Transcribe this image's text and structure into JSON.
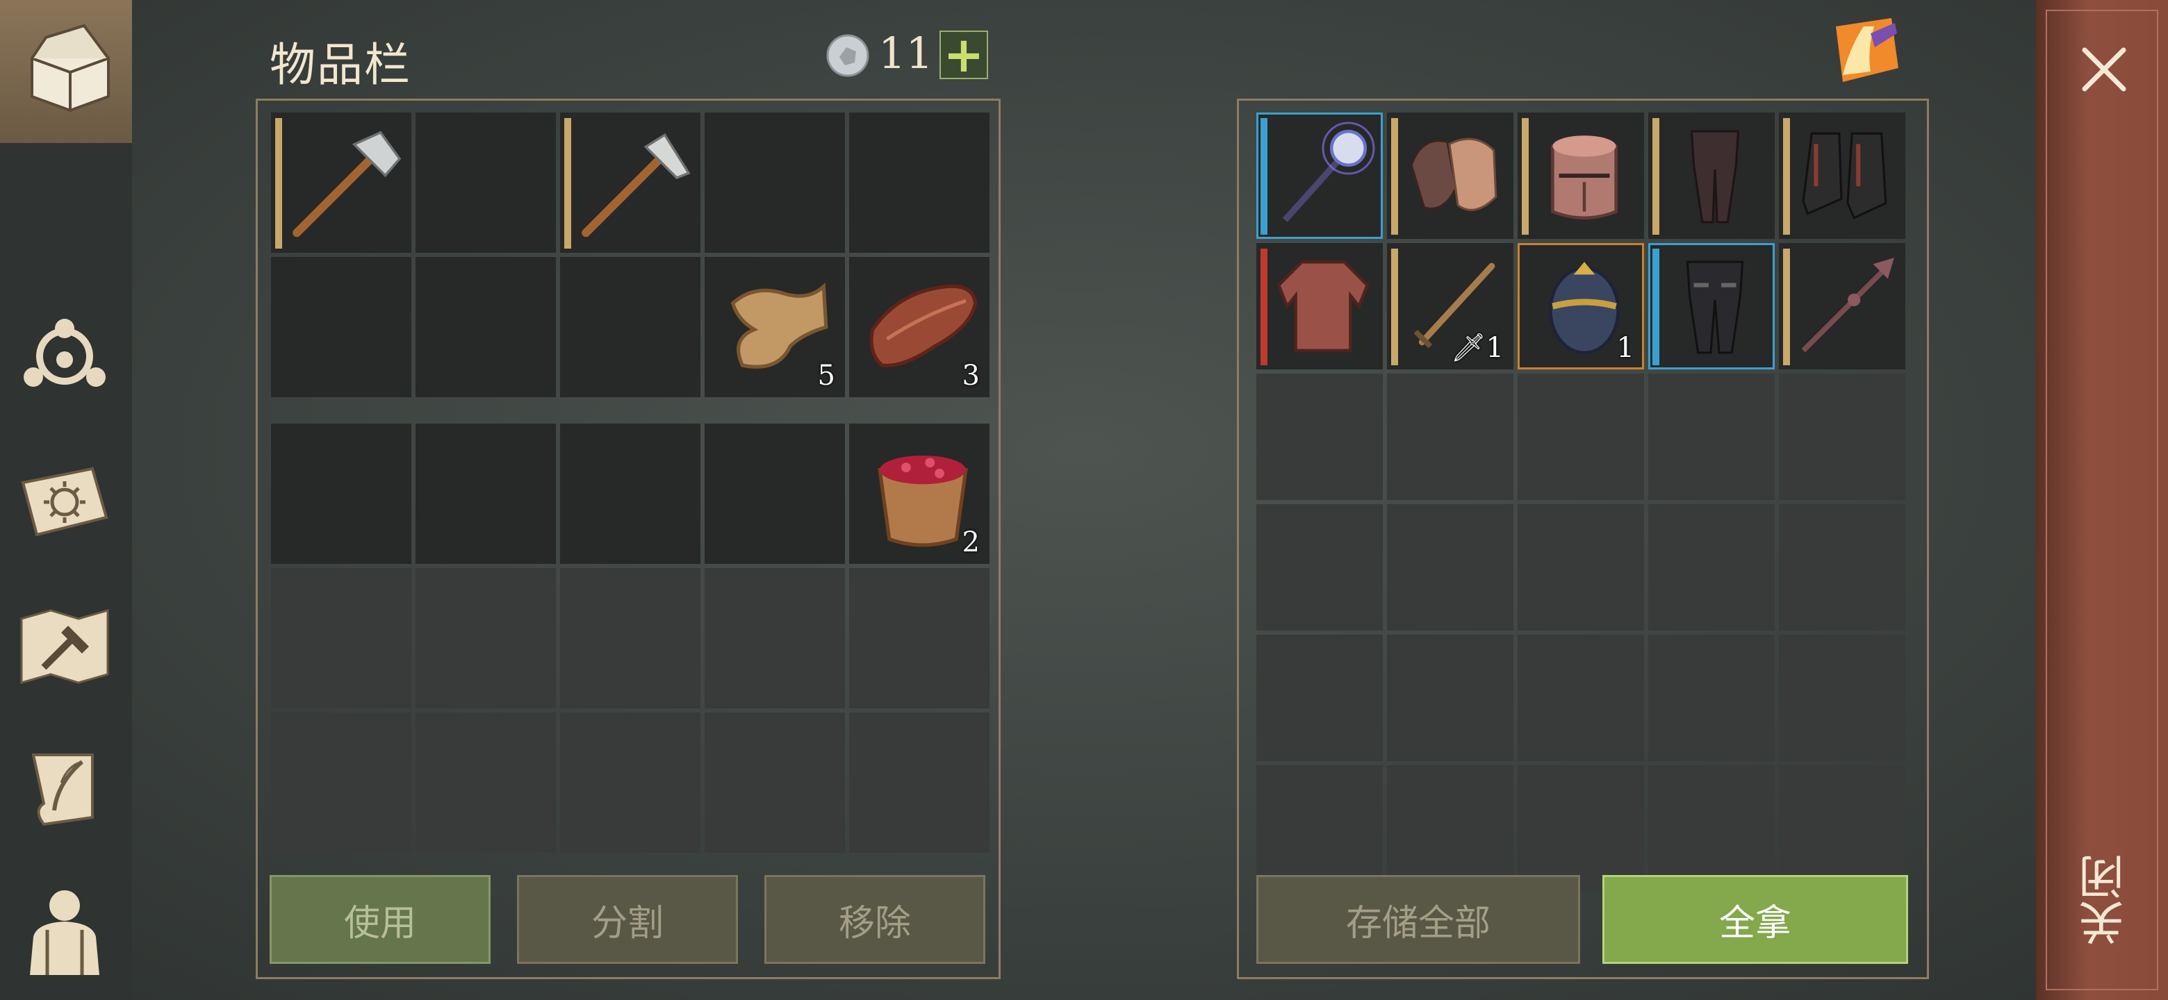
{
  "inventory": {
    "title": "物品栏",
    "currency_count": "11",
    "add_label": "+",
    "rows": [
      [
        {
          "item": "hammer-icon",
          "bar": "tan"
        },
        {
          "item": null
        },
        {
          "item": "pickaxe-icon",
          "bar": "tan"
        },
        {
          "item": null
        },
        {
          "item": null
        }
      ],
      [
        {
          "item": null
        },
        {
          "item": null
        },
        {
          "item": null
        },
        {
          "item": "cloth-icon",
          "qty": "5"
        },
        {
          "item": "leather-icon",
          "qty": "3"
        }
      ]
    ],
    "bottom_rows": [
      [
        {
          "item": null
        },
        {
          "item": null
        },
        {
          "item": null
        },
        {
          "item": null
        },
        {
          "item": "berry-bowl-icon",
          "qty": "2"
        }
      ]
    ],
    "buttons": {
      "use": "使用",
      "split": "分割",
      "remove": "移除"
    }
  },
  "container": {
    "rows": [
      [
        {
          "item": "mace-icon",
          "bar": "blue",
          "border": "blue"
        },
        {
          "item": "gloves-icon",
          "bar": "tan"
        },
        {
          "item": "great-helm-icon",
          "bar": "tan"
        },
        {
          "item": "leggings-icon",
          "bar": "tan"
        },
        {
          "item": "boots-icon",
          "bar": "tan"
        }
      ],
      [
        {
          "item": "chainmail-icon",
          "bar": "red"
        },
        {
          "item": "sword-icon",
          "bar": "tan",
          "qty": "1",
          "qty_prefix_icon": "dagger-mini-icon"
        },
        {
          "item": "egg-icon",
          "border": "orange",
          "qty": "1"
        },
        {
          "item": "armored-pants-icon",
          "bar": "blue",
          "border": "blue"
        },
        {
          "item": "spear-icon",
          "bar": "tan"
        }
      ]
    ],
    "buttons": {
      "store_all": "存储全部",
      "take_all": "全拿"
    }
  },
  "close_label": "关闭",
  "colors": {
    "accent_green": "#84a84c",
    "bar_tan": "#c9a86a",
    "bar_blue": "#3aa0d0",
    "bar_red": "#c0392b",
    "border_orange": "#c8822a"
  }
}
